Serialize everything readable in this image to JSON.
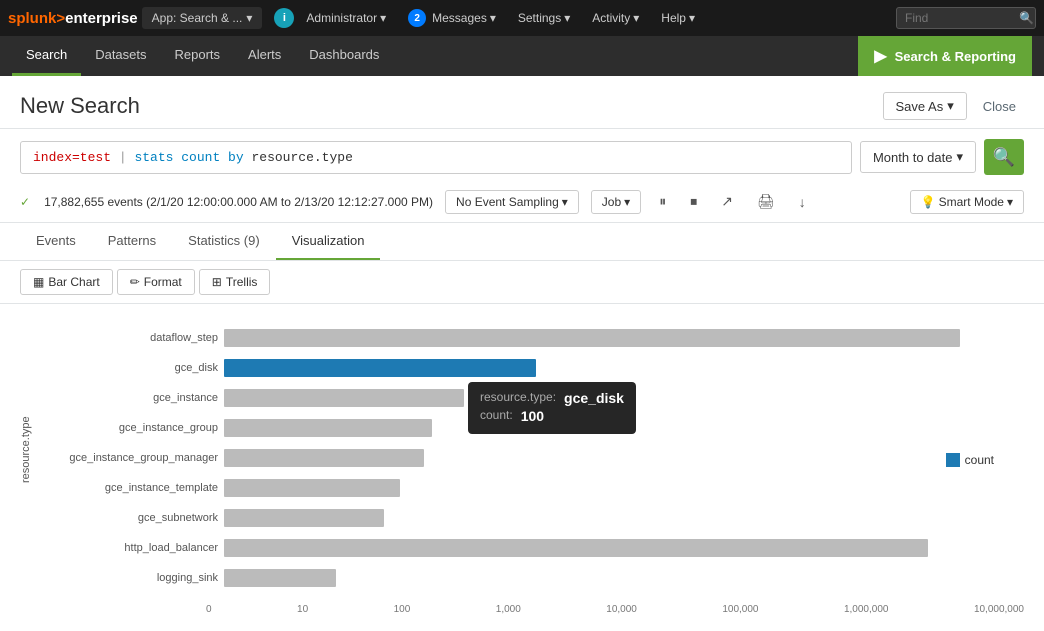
{
  "topnav": {
    "logo_splunk": "splunk>",
    "logo_enterprise": "enterprise",
    "app_label": "App: Search & ...",
    "info_badge": "i",
    "admin_label": "Administrator",
    "messages_count": "2",
    "messages_label": "Messages",
    "settings_label": "Settings",
    "activity_label": "Activity",
    "help_label": "Help",
    "find_placeholder": "Find"
  },
  "secondnav": {
    "items": [
      {
        "label": "Search",
        "active": true
      },
      {
        "label": "Datasets",
        "active": false
      },
      {
        "label": "Reports",
        "active": false
      },
      {
        "label": "Alerts",
        "active": false
      },
      {
        "label": "Dashboards",
        "active": false
      }
    ],
    "app_btn_icon": "▶",
    "app_btn_label": "Search & Reporting"
  },
  "page": {
    "title": "New Search",
    "save_as_label": "Save As",
    "close_label": "Close"
  },
  "search": {
    "query": "index=test  |  stats count by resource.type",
    "query_keyword": "index=test",
    "query_pipe": "|",
    "query_cmd": "stats count by",
    "query_field": "resource.type",
    "time_range": "Month to date",
    "run_icon": "🔍"
  },
  "status": {
    "check_icon": "✓",
    "text": "17,882,655 events (2/1/20 12:00:00.000 AM to 2/13/20 12:12:27.000 PM)",
    "sampling_label": "No Event Sampling",
    "job_label": "Job",
    "pause_icon": "⏸",
    "stop_icon": "⏹",
    "share_icon": "↗",
    "print_icon": "🖨",
    "export_icon": "↓",
    "smart_mode_label": "Smart Mode"
  },
  "tabs": [
    {
      "label": "Events",
      "active": false
    },
    {
      "label": "Patterns",
      "active": false
    },
    {
      "label": "Statistics (9)",
      "active": false
    },
    {
      "label": "Visualization",
      "active": true
    }
  ],
  "toolbar": [
    {
      "label": "Bar Chart",
      "icon": "▦"
    },
    {
      "label": "Format",
      "icon": "✏"
    },
    {
      "label": "Trellis",
      "icon": "⊞"
    }
  ],
  "chart": {
    "y_axis_label": "resource.type",
    "x_ticks": [
      "0",
      "10",
      "100",
      "1,000",
      "10,000",
      "100,000",
      "1,000,000",
      "10,000,000"
    ],
    "bars": [
      {
        "label": "dataflow_step",
        "width_pct": 92,
        "highlighted": false
      },
      {
        "label": "gce_disk",
        "width_pct": 39,
        "highlighted": true
      },
      {
        "label": "gce_instance",
        "width_pct": 30,
        "highlighted": false
      },
      {
        "label": "gce_instance_group",
        "width_pct": 26,
        "highlighted": false
      },
      {
        "label": "gce_instance_group_manager",
        "width_pct": 25,
        "highlighted": false
      },
      {
        "label": "gce_instance_template",
        "width_pct": 22,
        "highlighted": false
      },
      {
        "label": "gce_subnetwork",
        "width_pct": 20,
        "highlighted": false
      },
      {
        "label": "http_load_balancer",
        "width_pct": 88,
        "highlighted": false
      },
      {
        "label": "logging_sink",
        "width_pct": 14,
        "highlighted": false
      }
    ],
    "tooltip": {
      "key_label": "resource.type:",
      "key_value": "gce_disk",
      "count_label": "count:",
      "count_value": "100"
    },
    "legend_label": "count",
    "legend_color": "#1e7ab3"
  }
}
